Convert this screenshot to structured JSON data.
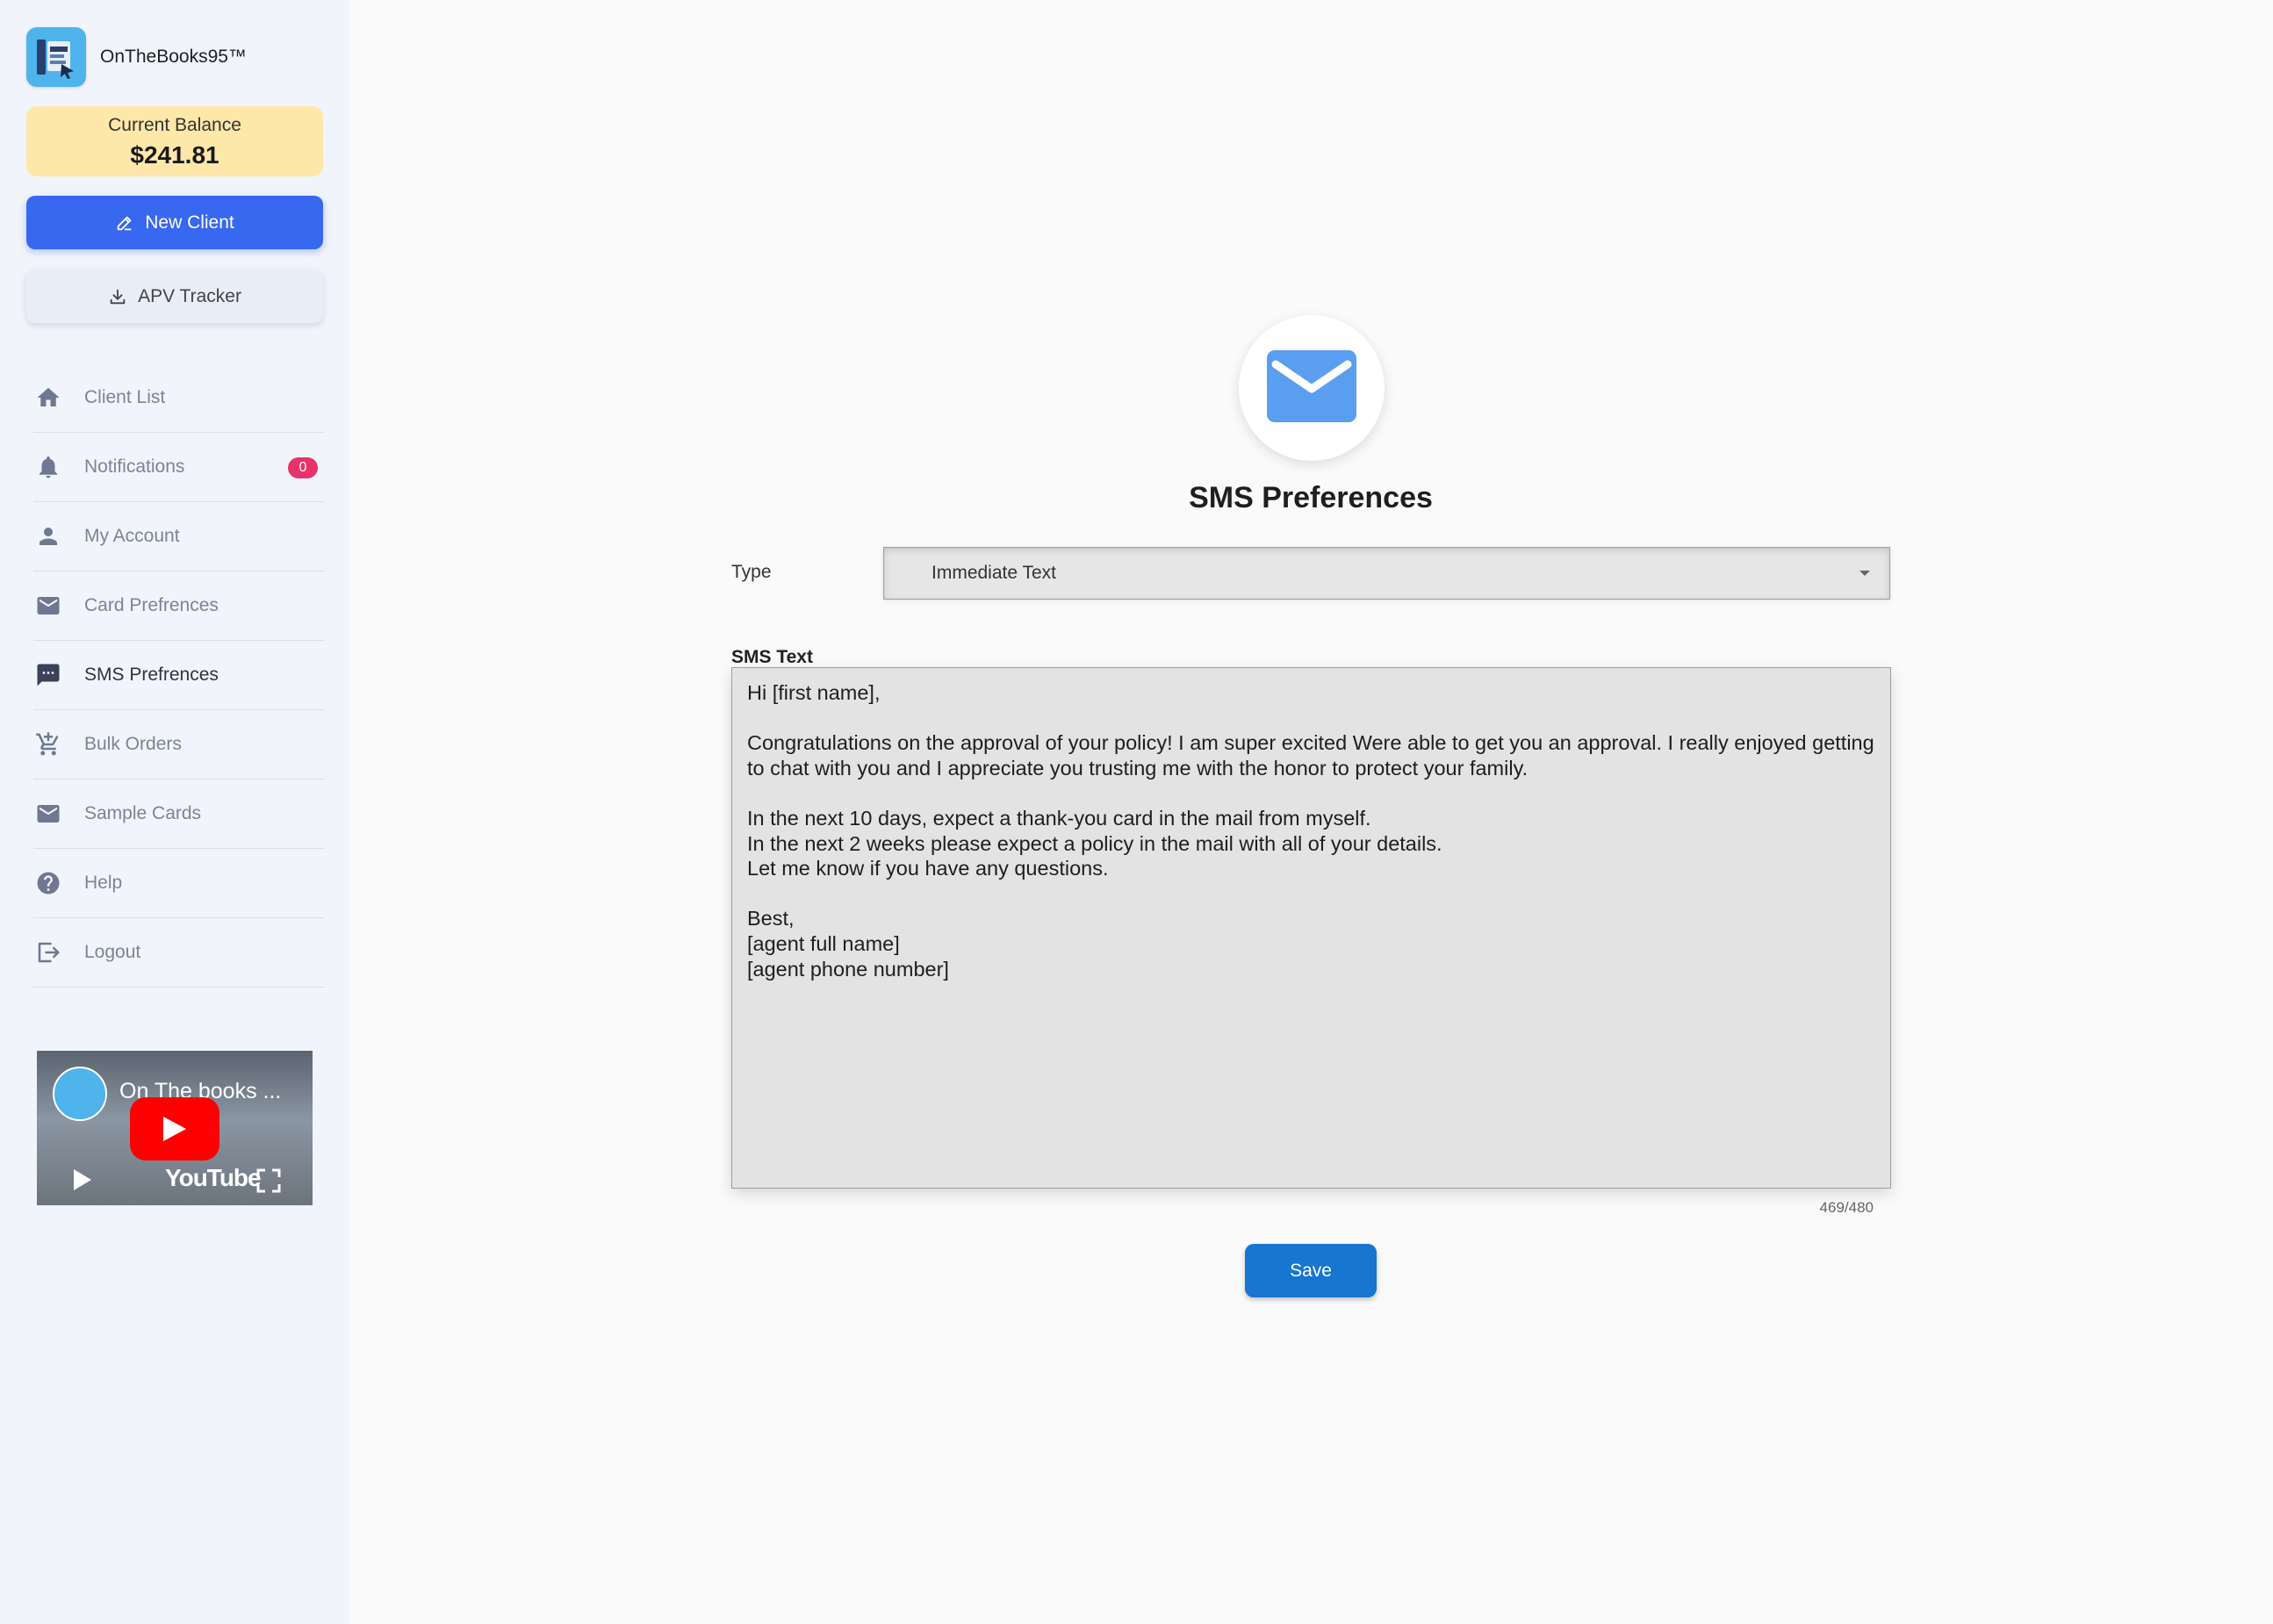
{
  "brand": {
    "name": "OnTheBooks95™"
  },
  "balance": {
    "label": "Current Balance",
    "value": "$241.81"
  },
  "actions": {
    "new_client": "New Client",
    "apv_tracker": "APV Tracker"
  },
  "nav": {
    "items": [
      {
        "label": "Client List",
        "icon": "home-icon"
      },
      {
        "label": "Notifications",
        "icon": "bell-icon",
        "badge": "0"
      },
      {
        "label": "My Account",
        "icon": "person-icon"
      },
      {
        "label": "Card Prefrences",
        "icon": "mail-icon"
      },
      {
        "label": "SMS Prefrences",
        "icon": "chat-icon",
        "active": true
      },
      {
        "label": "Bulk Orders",
        "icon": "cart-icon"
      },
      {
        "label": "Sample Cards",
        "icon": "mail-icon"
      },
      {
        "label": "Help",
        "icon": "help-icon"
      },
      {
        "label": "Logout",
        "icon": "logout-icon"
      }
    ]
  },
  "video": {
    "title": "On The books ...",
    "brand": "YouTube"
  },
  "main": {
    "title": "SMS Preferences",
    "type_label": "Type",
    "type_value": "Immediate Text",
    "sms_label": "SMS Text",
    "sms_text": "Hi [first name],\n\nCongratulations on the approval of your policy! I am super excited Were able to get you an approval. I really enjoyed getting to chat with you and I appreciate you trusting me with the honor to protect your family.\n\nIn the next 10 days, expect a thank-you card in the mail from myself.\nIn the next 2 weeks please expect a policy in the mail with all of your details.\nLet me know if you have any questions.\n\nBest,\n[agent full name]\n[agent phone number]",
    "counter": "469/480",
    "save_label": "Save"
  },
  "colors": {
    "primary": "#3867f0",
    "save": "#1776d2",
    "balance_bg": "#fde8a9",
    "badge": "#e8336a",
    "sidebar_bg": "#f1f4fb"
  }
}
